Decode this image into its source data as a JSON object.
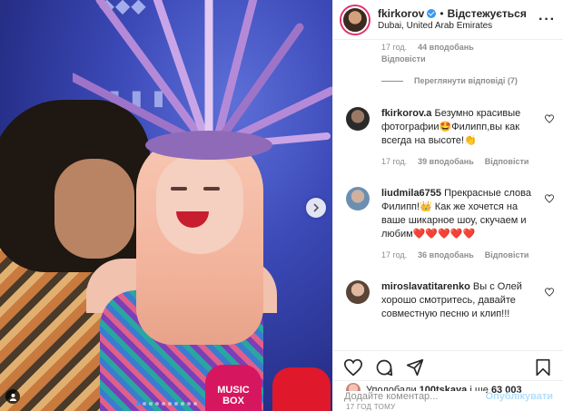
{
  "header": {
    "username": "fkirkorov",
    "separator": "•",
    "follow_status": "Відстежується",
    "location": "Dubai, United Arab Emirates"
  },
  "top_comment_meta": {
    "time": "17 год.",
    "likes": "44 вподобань"
  },
  "reply_label": "Відповісти",
  "view_replies": "Переглянути відповіді (7)",
  "photo": {
    "mic_label_1": "MUSIC",
    "mic_label_2": "BOX"
  },
  "comments": [
    {
      "username": "fkirkorov.a",
      "text": "Безумно красивые фотографии🤩Филипп,вы как всегда на высоте!👏",
      "time": "17 год.",
      "likes": "39 вподобань",
      "reply": "Відповісти"
    },
    {
      "username": "liudmila6755",
      "text": "Прекрасные слова Филипп!👑 Как же хочется на ваше шикарное шоу, скучаем и любим❤️❤️❤️❤️❤️",
      "time": "17 год.",
      "likes": "36 вподобань",
      "reply": "Відповісти"
    },
    {
      "username": "miroslavatitarenko",
      "text": "Вы с Олей хорошо смотритесь, давайте совместную песню и клип!!!"
    }
  ],
  "likes": {
    "prefix": "Уподобали ",
    "user": "100tskaya",
    "suffix": " і ще ",
    "count": "63 003"
  },
  "timestamp": "17 ГОД ТОМУ",
  "add_comment": {
    "placeholder": "Додайте коментар...",
    "post_label": "Опублікувати"
  },
  "carousel": {
    "total": 10,
    "active": 1
  },
  "colors": {
    "accent": "#3897f0",
    "post_disabled": "#b2dffc",
    "like_red": "#ed4956"
  }
}
